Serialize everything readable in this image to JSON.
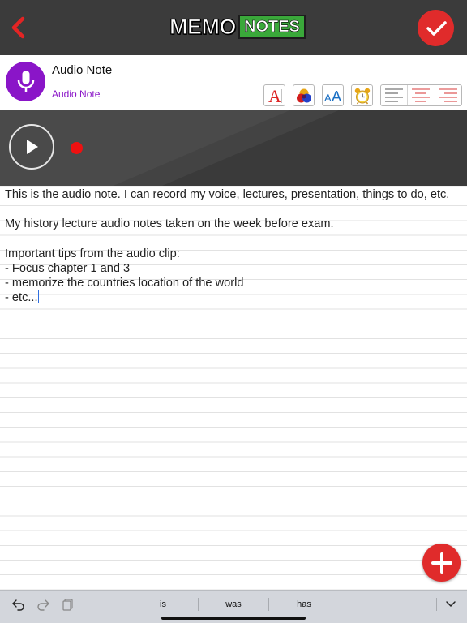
{
  "app": {
    "logo_memo": "MEMO",
    "logo_notes": "NOTES"
  },
  "note": {
    "title": "Audio Note",
    "category": "Audio Note",
    "body": "This is the audio note. I can record my voice, lectures, presentation, things to do, etc.\n\nMy history lecture audio notes taken on the week before exam.\n\nImportant tips from the audio clip:\n- Focus chapter 1 and 3\n- memorize the countries location of the world\n- etc..."
  },
  "toolbar": {
    "tools": [
      "font-color-icon",
      "color-palette-icon",
      "font-size-icon",
      "alarm-clock-icon"
    ],
    "align_options": [
      "align-left-icon",
      "align-center-icon",
      "align-right-icon"
    ]
  },
  "player": {
    "progress": 0
  },
  "keyboard": {
    "suggestions": [
      "is",
      "was",
      "has"
    ]
  },
  "colors": {
    "accent_red": "#e02b2b",
    "brand_purple": "#8a15c8",
    "logo_green": "#3aa83a",
    "bar_dark": "#3b3b3b"
  }
}
